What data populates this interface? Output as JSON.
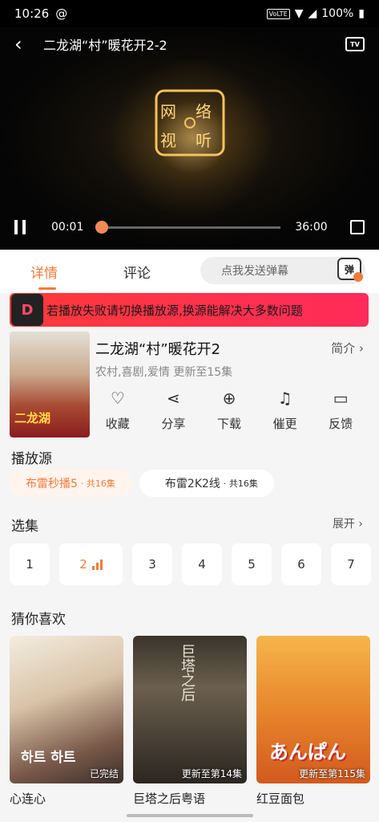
{
  "status_bar": {
    "time": "10:26",
    "network": "VoLTE",
    "battery": "100%"
  },
  "player": {
    "title": "二龙湖“村”暖花开2-2",
    "logo_text": "网络视听",
    "current_time": "00:01",
    "total_time": "36:00",
    "progress_fraction": 0.003
  },
  "tabs": {
    "details": "详情",
    "comments": "评论",
    "danmu_placeholder": "点我发送弹幕",
    "danmu_icon": "弹"
  },
  "banner": {
    "logo": "D",
    "text": "若播放失败请切换播放源,换源能解决大多数问题"
  },
  "show": {
    "poster_text": "二龙湖",
    "title": "二龙湖“村”暖花开2",
    "intro": "简介",
    "meta": "农村,喜剧,爱情 更新至15集"
  },
  "actions": [
    {
      "icon": "heart-icon",
      "label": "收藏"
    },
    {
      "icon": "share-icon",
      "label": "分享"
    },
    {
      "icon": "download-icon",
      "label": "下载"
    },
    {
      "icon": "bell-icon",
      "label": "催更"
    },
    {
      "icon": "feedback-icon",
      "label": "反馈"
    }
  ],
  "sources_section": {
    "title": "播放源"
  },
  "sources": [
    {
      "name": "布雷秒播5",
      "count": "· 共16集",
      "active": true
    },
    {
      "name": "布雷2K2线",
      "count": "· 共16集",
      "active": false
    }
  ],
  "episodes_section": {
    "title": "选集",
    "expand": "展开"
  },
  "episodes": [
    "1",
    "2",
    "3",
    "4",
    "5",
    "6",
    "7"
  ],
  "recommend_section": {
    "title": "猜你喜欢"
  },
  "recommendations": [
    {
      "name": "心连心",
      "badge": "已完结",
      "img_text": "하트 하트"
    },
    {
      "name": "巨塔之后粤语",
      "badge": "更新至第14集",
      "img_text": "巨塔之后"
    },
    {
      "name": "红豆面包",
      "badge": "更新至第115集",
      "img_text": "あんぱん"
    }
  ],
  "colors": {
    "accent": "#f07c3c",
    "banner": "#ff3a3a"
  }
}
